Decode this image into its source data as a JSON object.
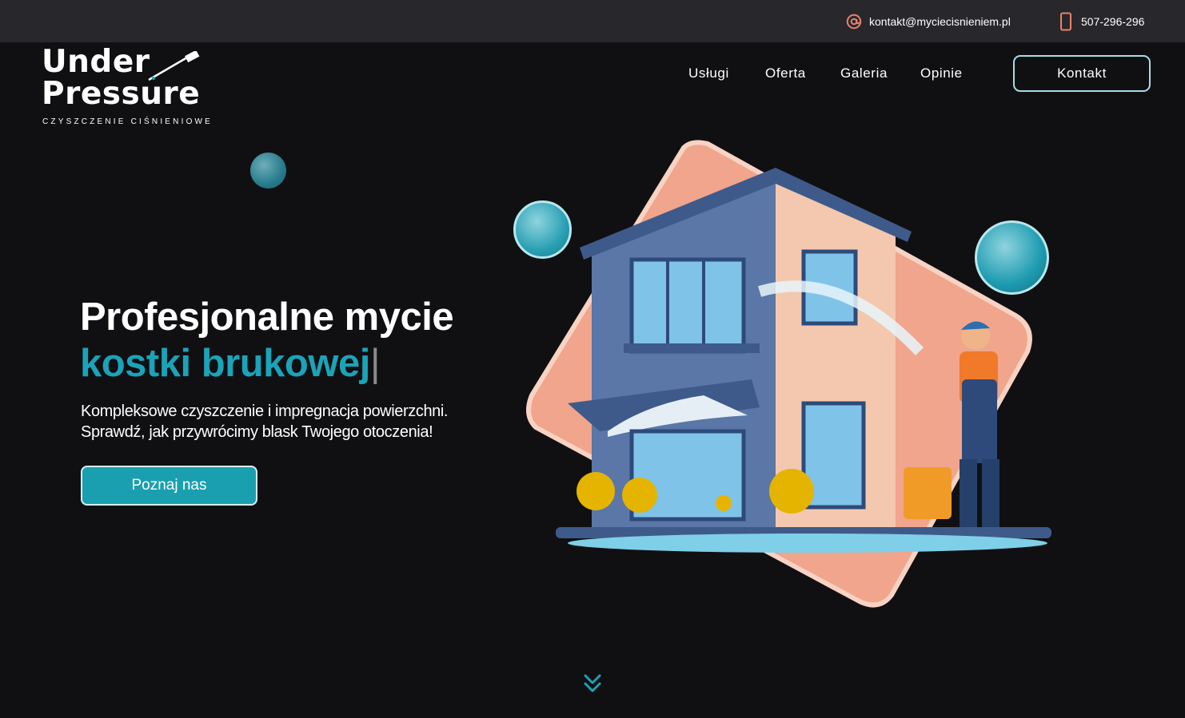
{
  "topbar": {
    "email": "kontakt@myciecisnieniem.pl",
    "phone": "507-296-296"
  },
  "logo": {
    "line1": "Under",
    "line2": "Pressure",
    "tagline": "CZYSZCZENIE CIŚNIENIOWE"
  },
  "nav": {
    "items": [
      {
        "label": "Usługi"
      },
      {
        "label": "Oferta"
      },
      {
        "label": "Galeria"
      },
      {
        "label": "Opinie"
      }
    ],
    "cta_label": "Kontakt"
  },
  "hero": {
    "title_line1": "Profesjonalne mycie",
    "title_line2": "kostki brukowej",
    "cursor": "|",
    "subtitle_line1": "Kompleksowe czyszczenie i impregnacja powierzchni.",
    "subtitle_line2": "Sprawdź, jak przywrócimy blask Twojego otoczenia!",
    "button_label": "Poznaj nas"
  },
  "colors": {
    "accent": "#1ba3b8",
    "background": "#101012",
    "topbar": "#28282c",
    "icon_orange": "#e8836a",
    "illustration_bg": "#f0a58c"
  },
  "icons": {
    "email": "at-icon",
    "phone": "smartphone-icon",
    "scroll": "double-chevron-down-icon"
  }
}
